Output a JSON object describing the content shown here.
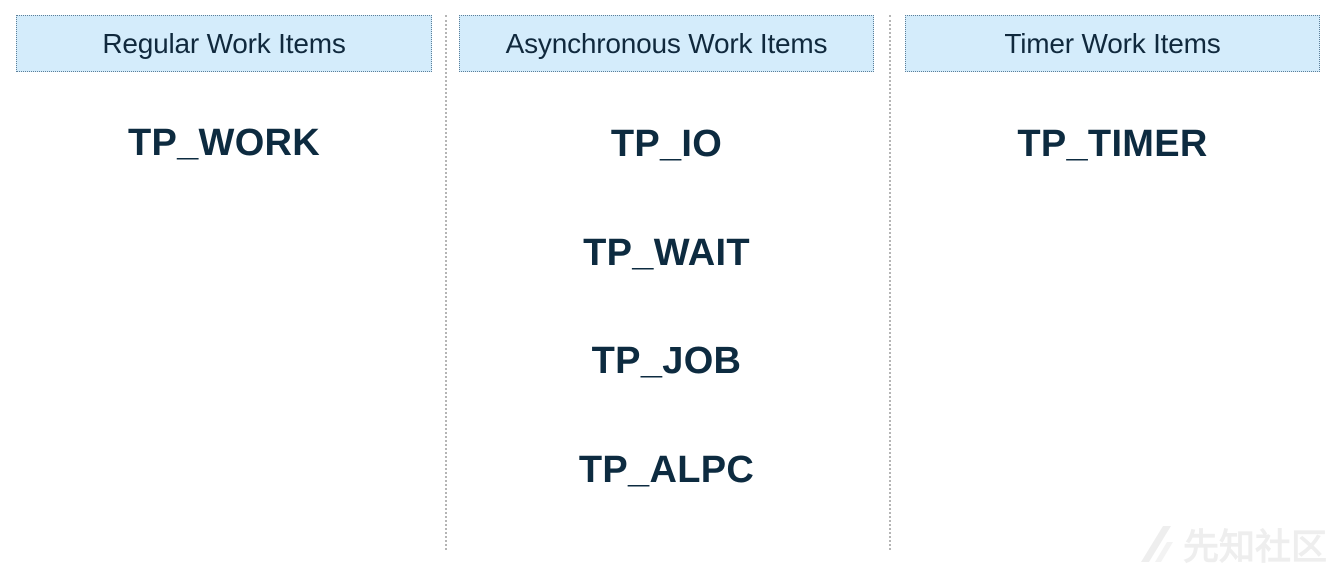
{
  "columns": [
    {
      "header": "Regular Work Items",
      "items": [
        "TP_WORK"
      ]
    },
    {
      "header": "Asynchronous Work Items",
      "items": [
        "TP_IO",
        "TP_WAIT",
        "TP_JOB",
        "TP_ALPC"
      ]
    },
    {
      "header": "Timer Work Items",
      "items": [
        "TP_TIMER"
      ]
    }
  ],
  "watermark": {
    "text": "先知社区",
    "icon": "slash-logo-icon"
  },
  "colors": {
    "header_background": "#d4ecfb",
    "header_border": "#5d7f99",
    "text": "#0d2b40",
    "divider": "#b5b5b5"
  }
}
